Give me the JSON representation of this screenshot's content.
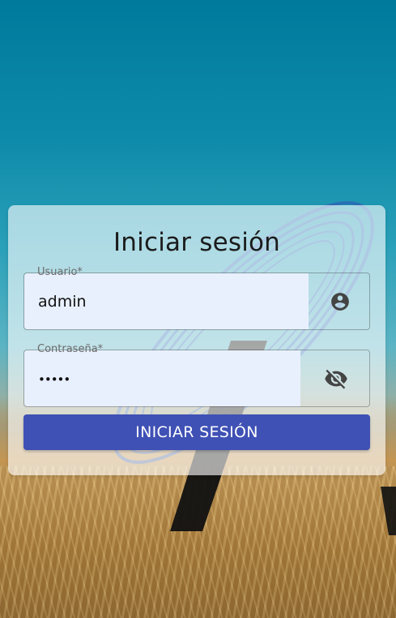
{
  "login": {
    "title": "Iniciar sesión",
    "username": {
      "label": "Usuario",
      "required_mark": "*",
      "value": "admin",
      "icon": "account-circle-icon"
    },
    "password": {
      "label": "Contraseña",
      "required_mark": "*",
      "value": "•••••",
      "icon": "visibility-off-icon"
    },
    "submit_label": "INICIAR SESIÓN"
  },
  "colors": {
    "primary": "#3f51b5",
    "autofill_bg": "#e8f0fe",
    "card_overlay": "rgba(255,255,255,0.62)"
  }
}
